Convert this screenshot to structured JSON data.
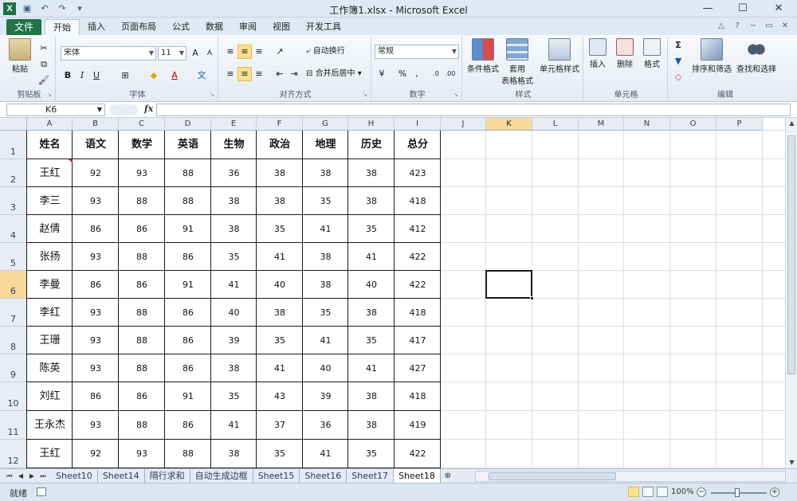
{
  "window": {
    "title": "工作簿1.xlsx - Microsoft Excel",
    "app_icon": "X"
  },
  "ribbon_tabs": {
    "file": "文件",
    "tabs": [
      "开始",
      "插入",
      "页面布局",
      "公式",
      "数据",
      "审阅",
      "视图",
      "开发工具"
    ],
    "active": "开始"
  },
  "clipboard": {
    "paste": "粘贴",
    "label": "剪贴板"
  },
  "font": {
    "name": "宋体",
    "size": "11",
    "label": "字体",
    "bold": "B",
    "italic": "I",
    "underline": "U"
  },
  "alignment": {
    "wrap": "自动换行",
    "merge": "合并后居中",
    "label": "对齐方式"
  },
  "number": {
    "format": "常规",
    "percent": "%",
    "comma": ",",
    "label": "数字"
  },
  "styles": {
    "cond": "条件格式",
    "table_1": "套用",
    "table_2": "表格格式",
    "cell": "单元格样式",
    "label": "样式"
  },
  "cells": {
    "insert": "插入",
    "delete": "删除",
    "format": "格式",
    "label": "单元格"
  },
  "editing": {
    "sort": "排序和筛选",
    "find": "查找和选择",
    "label": "编辑",
    "sum": "Σ"
  },
  "formula_bar": {
    "name_box": "K6",
    "fx": "fx",
    "value": ""
  },
  "columns": [
    "A",
    "B",
    "C",
    "D",
    "E",
    "F",
    "G",
    "H",
    "I",
    "J",
    "K",
    "L",
    "M",
    "N",
    "O",
    "P"
  ],
  "selected_column": "K",
  "rows": [
    "1",
    "2",
    "3",
    "4",
    "5",
    "6",
    "7",
    "8",
    "9",
    "10",
    "11",
    "12"
  ],
  "selected_row": "6",
  "table": {
    "headers": [
      "姓名",
      "语文",
      "数学",
      "英语",
      "生物",
      "政治",
      "地理",
      "历史",
      "总分"
    ],
    "data": [
      [
        "王红",
        "92",
        "93",
        "88",
        "36",
        "38",
        "38",
        "38",
        "423"
      ],
      [
        "李三",
        "93",
        "88",
        "88",
        "38",
        "38",
        "35",
        "38",
        "418"
      ],
      [
        "赵倩",
        "86",
        "86",
        "91",
        "38",
        "35",
        "41",
        "35",
        "412"
      ],
      [
        "张扬",
        "93",
        "88",
        "86",
        "35",
        "41",
        "38",
        "41",
        "422"
      ],
      [
        "李曼",
        "86",
        "86",
        "91",
        "41",
        "40",
        "38",
        "40",
        "422"
      ],
      [
        "李红",
        "93",
        "88",
        "86",
        "40",
        "38",
        "35",
        "38",
        "418"
      ],
      [
        "王珊",
        "93",
        "88",
        "86",
        "39",
        "35",
        "41",
        "35",
        "417"
      ],
      [
        "陈英",
        "93",
        "88",
        "86",
        "38",
        "41",
        "40",
        "41",
        "427"
      ],
      [
        "刘红",
        "86",
        "86",
        "91",
        "35",
        "43",
        "39",
        "38",
        "418"
      ],
      [
        "王永杰",
        "93",
        "88",
        "86",
        "41",
        "37",
        "36",
        "38",
        "419"
      ],
      [
        "王红",
        "92",
        "93",
        "88",
        "38",
        "35",
        "41",
        "35",
        "422"
      ]
    ]
  },
  "sheets": [
    "Sheet10",
    "Sheet14",
    "隔行求和",
    "自动生成边框",
    "Sheet15",
    "Sheet16",
    "Sheet17",
    "Sheet18"
  ],
  "active_sheet": "Sheet18",
  "status": {
    "ready": "就绪",
    "zoom": "100%"
  }
}
